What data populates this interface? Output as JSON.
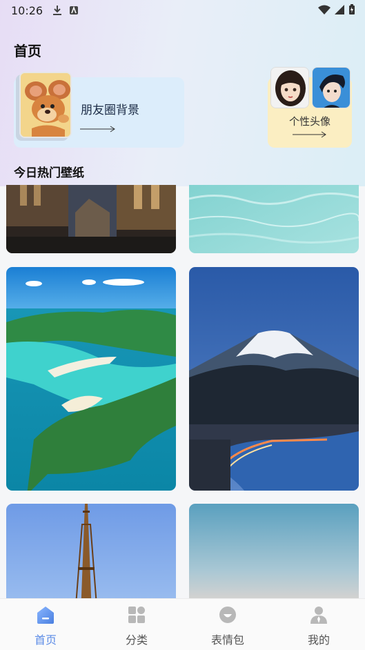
{
  "status_bar": {
    "time": "10:26"
  },
  "header": {
    "title": "首页"
  },
  "featured": {
    "moments_label": "朋友圈背景",
    "avatar_label": "个性头像"
  },
  "section": {
    "title": "今日热门壁纸"
  },
  "tabbar": {
    "items": [
      {
        "label": "首页",
        "icon": "home-icon",
        "active": true
      },
      {
        "label": "分类",
        "icon": "category-icon",
        "active": false
      },
      {
        "label": "表情包",
        "icon": "emoji-icon",
        "active": false
      },
      {
        "label": "我的",
        "icon": "profile-icon",
        "active": false
      }
    ]
  },
  "colors": {
    "accent": "#5b8be6",
    "moments_card": "#dcedfb",
    "avatar_card": "#fbeec2"
  }
}
